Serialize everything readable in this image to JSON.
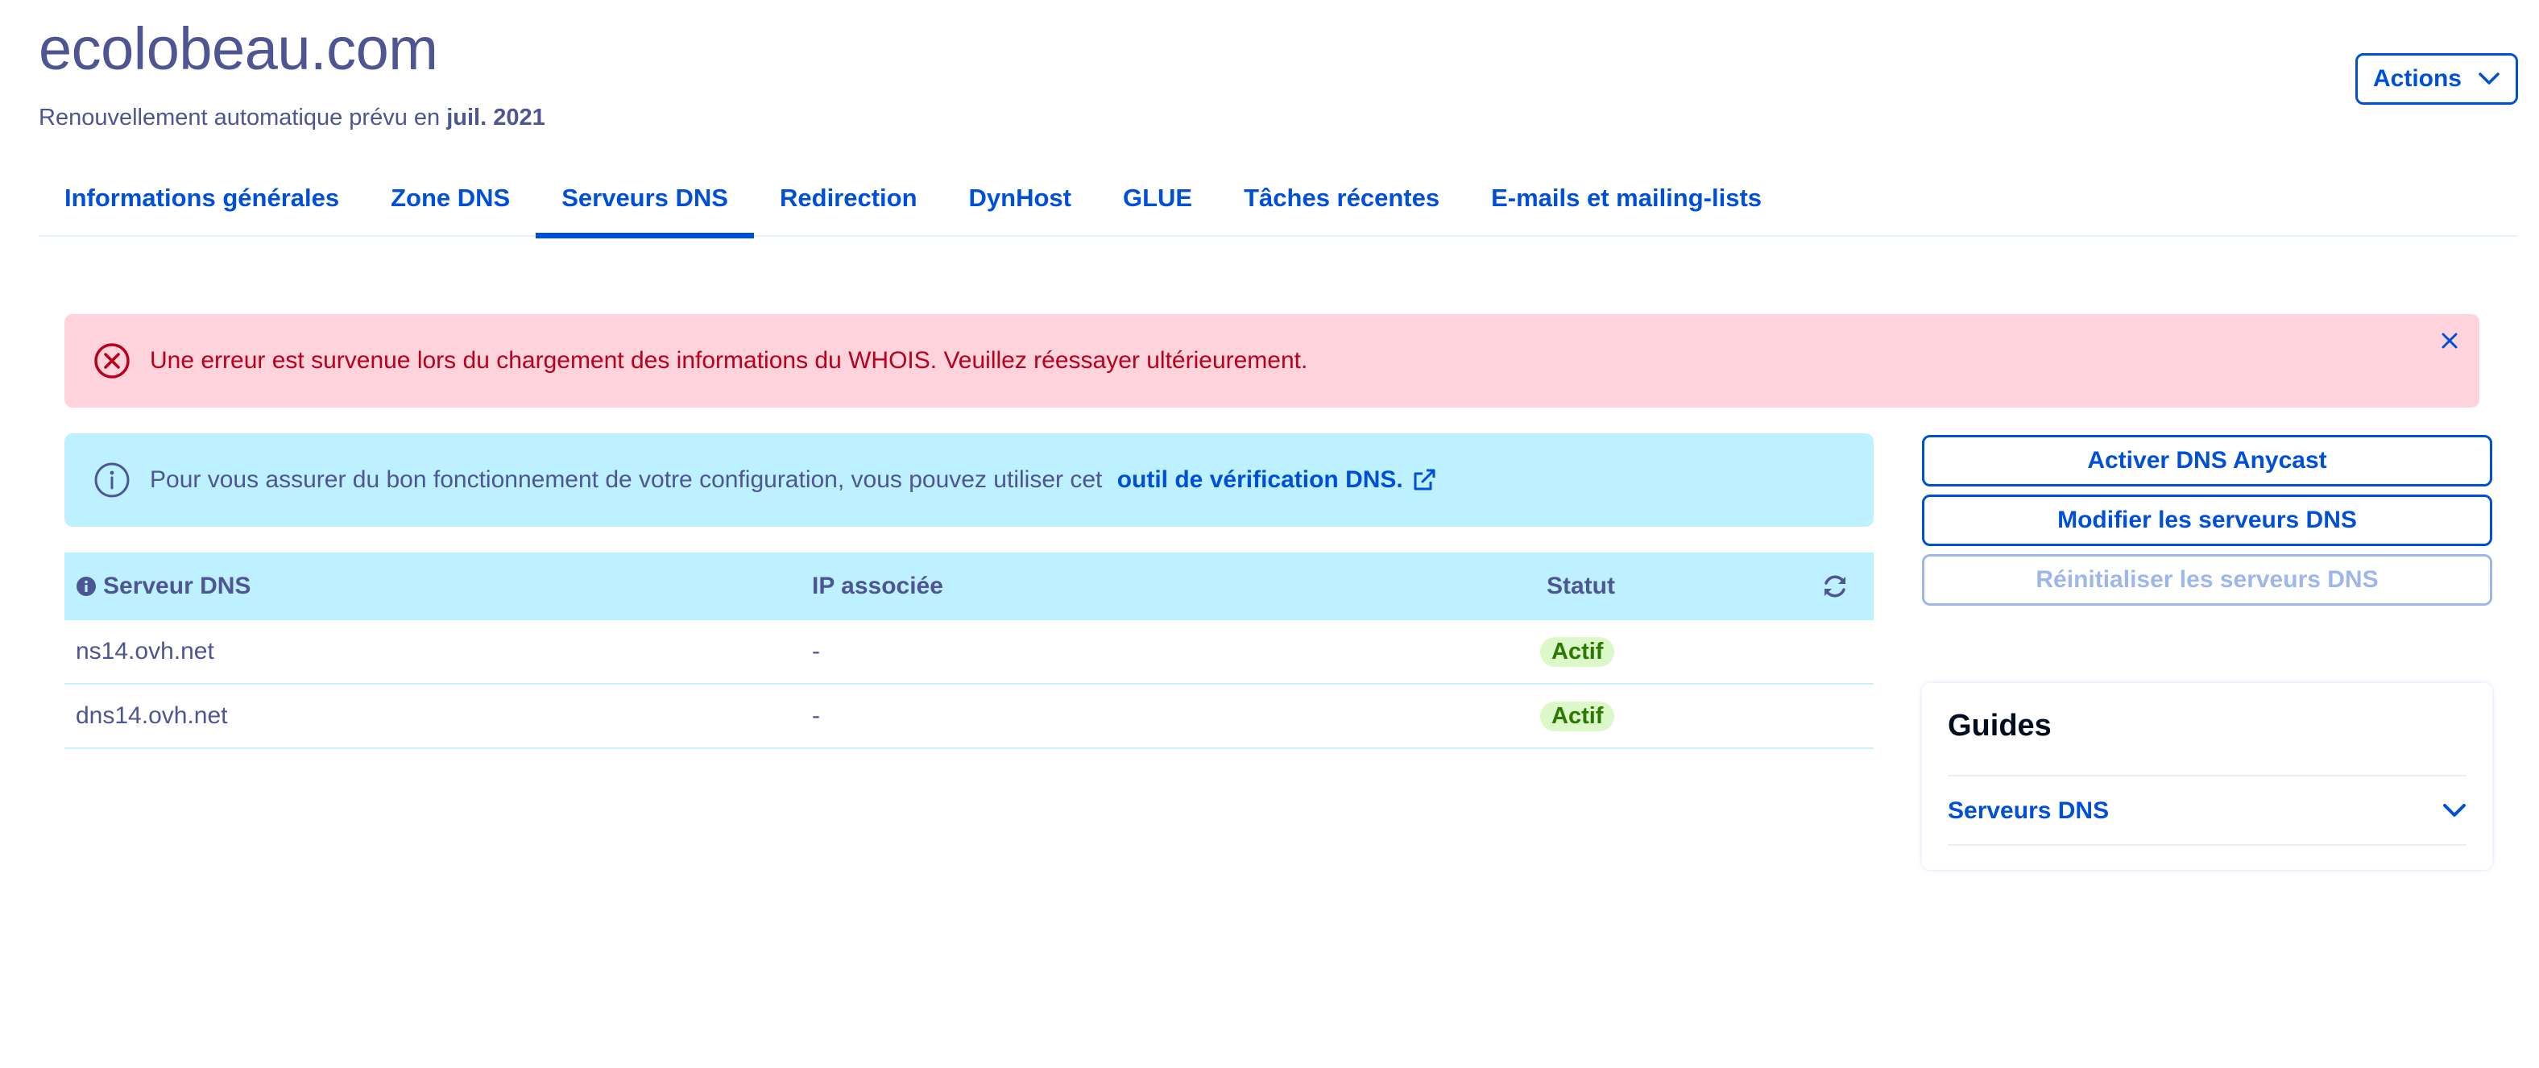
{
  "header": {
    "title": "ecolobeau.com",
    "renewal_prefix": "Renouvellement automatique prévu en ",
    "renewal_date": "juil. 2021",
    "actions_label": "Actions"
  },
  "tabs": [
    {
      "label": "Informations générales",
      "active": false
    },
    {
      "label": "Zone DNS",
      "active": false
    },
    {
      "label": "Serveurs DNS",
      "active": true
    },
    {
      "label": "Redirection",
      "active": false
    },
    {
      "label": "DynHost",
      "active": false
    },
    {
      "label": "GLUE",
      "active": false
    },
    {
      "label": "Tâches récentes",
      "active": false
    },
    {
      "label": "E-mails et mailing-lists",
      "active": false
    }
  ],
  "error_banner": {
    "message": "Une erreur est survenue lors du chargement des informations du WHOIS. Veuillez réessayer ultérieurement."
  },
  "info_banner": {
    "message": "Pour vous assurer du bon fonctionnement de votre configuration, vous pouvez utiliser cet",
    "link_label": "outil de vérification DNS."
  },
  "table": {
    "headers": {
      "server": "Serveur DNS",
      "ip": "IP associée",
      "status": "Statut"
    },
    "rows": [
      {
        "server": "ns14.ovh.net",
        "ip": "-",
        "status": "Actif"
      },
      {
        "server": "dns14.ovh.net",
        "ip": "-",
        "status": "Actif"
      }
    ]
  },
  "side_buttons": {
    "activate_anycast": "Activer DNS Anycast",
    "modify_servers": "Modifier les serveurs DNS",
    "reset_servers": "Réinitialiser les serveurs DNS"
  },
  "guides": {
    "title": "Guides",
    "item_label": "Serveurs DNS"
  },
  "colors": {
    "primary": "#0050d7",
    "text": "#4d5592",
    "error_bg": "#ffd3dc",
    "error_text": "#b8001d",
    "info_bg": "#bef1ff",
    "success_bg": "#dcf8c8",
    "success_text": "#2b7a00"
  }
}
